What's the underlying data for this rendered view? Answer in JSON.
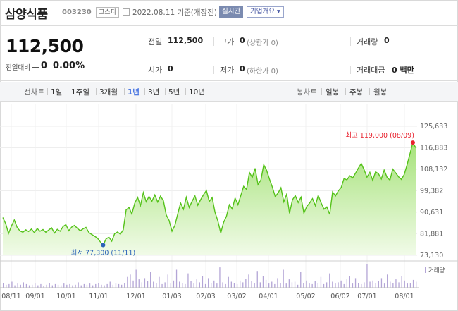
{
  "header": {
    "stock_name": "삼양식품",
    "stock_code": "003230",
    "market": "코스피",
    "date_text": "2022.08.11 기준(개장전)",
    "realtime_label": "실시간",
    "company_label": "기업개요 ▾"
  },
  "summary": {
    "price": "112,500",
    "prev_label": "전일대비",
    "change": "0",
    "change_pct": "0.00%",
    "prev_close_label": "전일",
    "prev_close": "112,500",
    "high_label": "고가",
    "high": "0",
    "high_sub": "(상한가 0)",
    "volume_label": "거래량",
    "volume": "0",
    "open_label": "시가",
    "open": "0",
    "low_label": "저가",
    "low": "0",
    "low_sub": "(하한가 0)",
    "amount_label": "거래대금",
    "amount": "0 백만"
  },
  "period_bar": {
    "line_label": "선차트",
    "periods": [
      "1일",
      "1주일",
      "3개월",
      "1년",
      "3년",
      "5년",
      "10년"
    ],
    "active_period": "1년",
    "candle_label": "봉차트",
    "candles": [
      "일봉",
      "주봉",
      "월봉"
    ]
  },
  "colors": {
    "line": "#55c21a",
    "area_top": "#a6e27a",
    "area_bottom": "#f1fbe8",
    "volume_bar": "#b3a5d6",
    "max_dot": "#e8232f",
    "min_dot": "#2a62b8",
    "active_period": "#3d6ce0"
  },
  "chart_data": {
    "type": "area",
    "y_ticks": [
      "125,633",
      "116,883",
      "108,132",
      "99,382",
      "90,631",
      "81,881",
      "73,130"
    ],
    "ylim": [
      73130,
      125633
    ],
    "x_ticks": [
      "08/11",
      "09/01",
      "10/01",
      "11/01",
      "12/01",
      "01/03",
      "02/03",
      "03/02",
      "04/01",
      "05/02",
      "06/02",
      "07/01",
      "08/01"
    ],
    "max_label": "최고 119,000 (08/09)",
    "min_label": "최저 77,300 (11/11)",
    "volume_legend": "거래량",
    "price_series": [
      88500,
      86000,
      82000,
      85000,
      87500,
      84500,
      83000,
      82500,
      83500,
      82800,
      83800,
      82300,
      84000,
      82900,
      83600,
      82500,
      83400,
      84300,
      82200,
      83700,
      82900,
      84800,
      85600,
      83100,
      84600,
      85300,
      84100,
      83100,
      83900,
      84500,
      82400,
      81600,
      80900,
      80100,
      78600,
      77300,
      79800,
      80500,
      78900,
      81900,
      82600,
      81700,
      83500,
      91600,
      92600,
      89900,
      94300,
      96700,
      93300,
      98600,
      94900,
      97100,
      95100,
      97700,
      94800,
      97200,
      95300,
      89500,
      87300,
      82900,
      85300,
      89900,
      94400,
      91900,
      96700,
      92600,
      95100,
      97300,
      93500,
      95800,
      97800,
      99500,
      95000,
      96600,
      90700,
      87100,
      82200,
      86500,
      89000,
      93700,
      92000,
      96400,
      93700,
      97500,
      101200,
      99900,
      106800,
      104800,
      108500,
      101900,
      103800,
      110000,
      107700,
      104100,
      100900,
      97000,
      98500,
      100600,
      94900,
      98000,
      90200,
      95700,
      97400,
      94600,
      96800,
      90300,
      93000,
      94400,
      96200,
      93300,
      97500,
      94500,
      91900,
      92800,
      89800,
      98900,
      97300,
      99300,
      100700,
      104400,
      103800,
      105500,
      104600,
      106500,
      108600,
      110500,
      107900,
      104900,
      106900,
      103600,
      107100,
      106300,
      104200,
      107800,
      104900,
      103700,
      108200,
      106700,
      105100,
      104000,
      106000,
      110000,
      114500,
      119000,
      116900
    ],
    "volume_series": [
      8,
      5,
      6,
      10,
      4,
      7,
      5,
      9,
      6,
      4,
      5,
      7,
      4,
      6,
      3,
      5,
      8,
      4,
      6,
      5,
      4,
      7,
      5,
      6,
      4,
      5,
      9,
      4,
      6,
      5,
      7,
      4,
      6,
      8,
      5,
      4,
      6,
      10,
      5,
      7,
      6,
      5,
      8,
      18,
      22,
      12,
      30,
      14,
      9,
      16,
      11,
      26,
      10,
      8,
      18,
      6,
      9,
      22,
      7,
      12,
      30,
      10,
      8,
      6,
      24,
      11,
      7,
      14,
      9,
      20,
      6,
      16,
      8,
      12,
      7,
      34,
      9,
      6,
      18,
      10,
      8,
      6,
      12,
      9,
      15,
      22,
      11,
      8,
      28,
      9,
      20,
      13,
      7,
      10,
      6,
      16,
      8,
      30,
      7,
      14,
      9,
      10,
      5,
      26,
      8,
      12,
      7,
      6,
      11,
      8,
      18,
      6,
      9,
      24,
      10,
      7,
      9,
      12,
      6,
      14,
      20,
      7,
      16,
      8,
      6,
      9,
      40,
      10,
      12,
      8,
      11,
      16,
      7,
      22,
      10,
      8,
      14,
      9,
      19,
      12,
      7,
      8,
      13,
      10
    ]
  }
}
